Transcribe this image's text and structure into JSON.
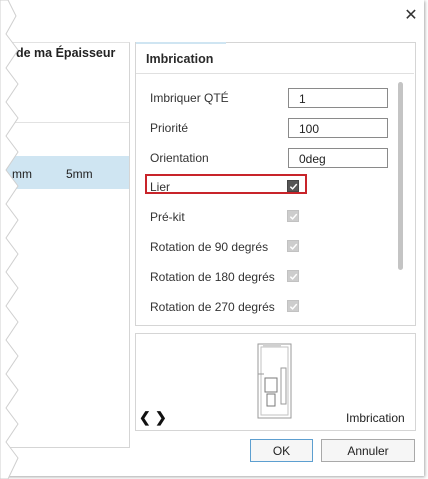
{
  "window": {
    "close_glyph": "✕"
  },
  "left_panel": {
    "column_header": "de ma Épaisseur",
    "row": {
      "cell_1": "mm",
      "cell_2": "5mm"
    }
  },
  "imbrication_panel": {
    "title": "Imbrication",
    "fields": [
      {
        "label": "Imbriquer QTÉ",
        "value": "1"
      },
      {
        "label": "Priorité",
        "value": "100"
      },
      {
        "label": "Orientation",
        "value": "0deg"
      }
    ],
    "checkboxes": [
      {
        "label": "Lier",
        "checked": true,
        "enabled": true
      },
      {
        "label": "Pré-kit",
        "checked": true,
        "enabled": false
      },
      {
        "label": "Rotation de 90 degrés",
        "checked": true,
        "enabled": false
      },
      {
        "label": "Rotation de 180 degrés",
        "checked": true,
        "enabled": false
      },
      {
        "label": "Rotation de 270 degrés",
        "checked": true,
        "enabled": false
      }
    ]
  },
  "preview": {
    "label": "Imbrication",
    "prev_glyph": "❮",
    "next_glyph": "❯"
  },
  "buttons": {
    "ok": "OK",
    "cancel": "Annuler"
  },
  "colors": {
    "highlight_border": "#c8242a",
    "selected_row": "#cfe5f2",
    "primary_button_border": "#5d9fd0"
  }
}
